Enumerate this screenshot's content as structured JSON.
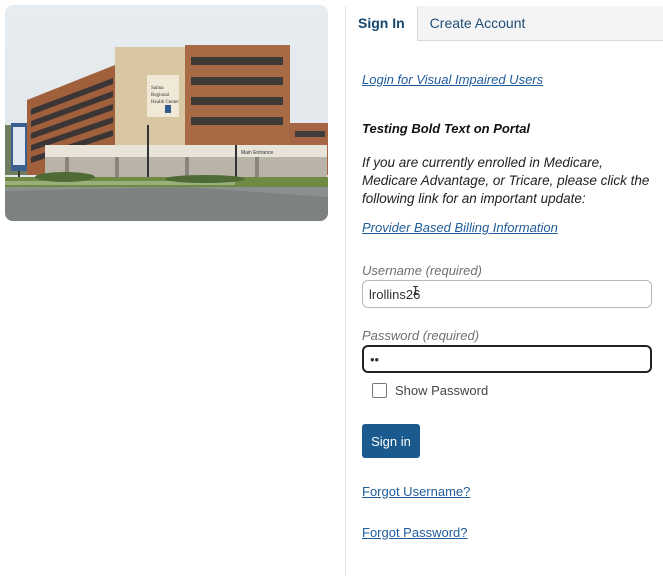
{
  "tabs": {
    "signin": "Sign In",
    "create": "Create Account"
  },
  "links": {
    "visual_impaired": "Login for Visual Impaired Users",
    "billing": "Provider Based Billing Information",
    "forgot_username": "Forgot Username?",
    "forgot_password": "Forgot Password?"
  },
  "notes": {
    "bold_text": "Testing Bold Text on Portal",
    "medicare": "If you are currently enrolled in Medicare, Medicare Advantage, or Tricare, please click the following link for an important update:"
  },
  "form": {
    "username_label": "Username (required)",
    "username_value": "lrollins26",
    "password_label": "Password (required)",
    "password_value": "••",
    "show_password_label": "Show Password",
    "signin_button": "Sign in"
  },
  "photo": {
    "sign_text": "Salina Regional Health Center",
    "entrance_text": "Main Entrance"
  },
  "colors": {
    "accent": "#1b5a8f",
    "link": "#1f5c9a"
  }
}
